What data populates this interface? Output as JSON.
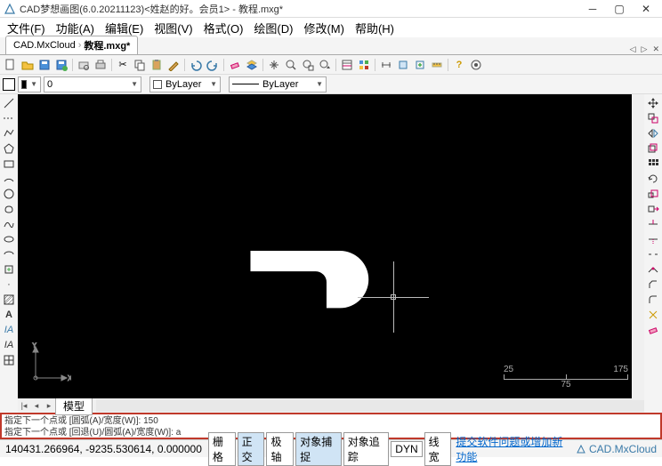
{
  "titlebar": {
    "title": "CAD梦想画图(6.0.20211123)<姓赵的好。会员1> - 教程.mxg*"
  },
  "menu": {
    "file": "文件(F)",
    "func": "功能(A)",
    "edit": "编辑(E)",
    "view": "视图(V)",
    "format": "格式(O)",
    "draw": "绘图(D)",
    "modify": "修改(M)",
    "help": "帮助(H)"
  },
  "doctab": {
    "cloud": "CAD.MxCloud",
    "name": "教程.mxg*"
  },
  "props": {
    "layer": "0",
    "color_combo": "ByLayer",
    "linetype": "ByLayer"
  },
  "modeltab": {
    "label": "模型"
  },
  "scale": {
    "t1": "25",
    "t2": "175",
    "mid": "75"
  },
  "cmd": {
    "line1": "指定下一个点或 [圆弧(A)/宽度(W)]: 150",
    "line2": "指定下一个点或 [回退(U)/圆弧(A)/宽度(W)]: a"
  },
  "status": {
    "coords": "140431.266964,  -9235.530614,  0.000000",
    "grid": "栅格",
    "ortho": "正交",
    "polar": "极轴",
    "osnap": "对象捕捉",
    "otrack": "对象追踪",
    "dyn": "DYN",
    "lwt": "线宽",
    "feedback": "提交软件问题或增加新功能",
    "brand": "CAD.MxCloud"
  }
}
